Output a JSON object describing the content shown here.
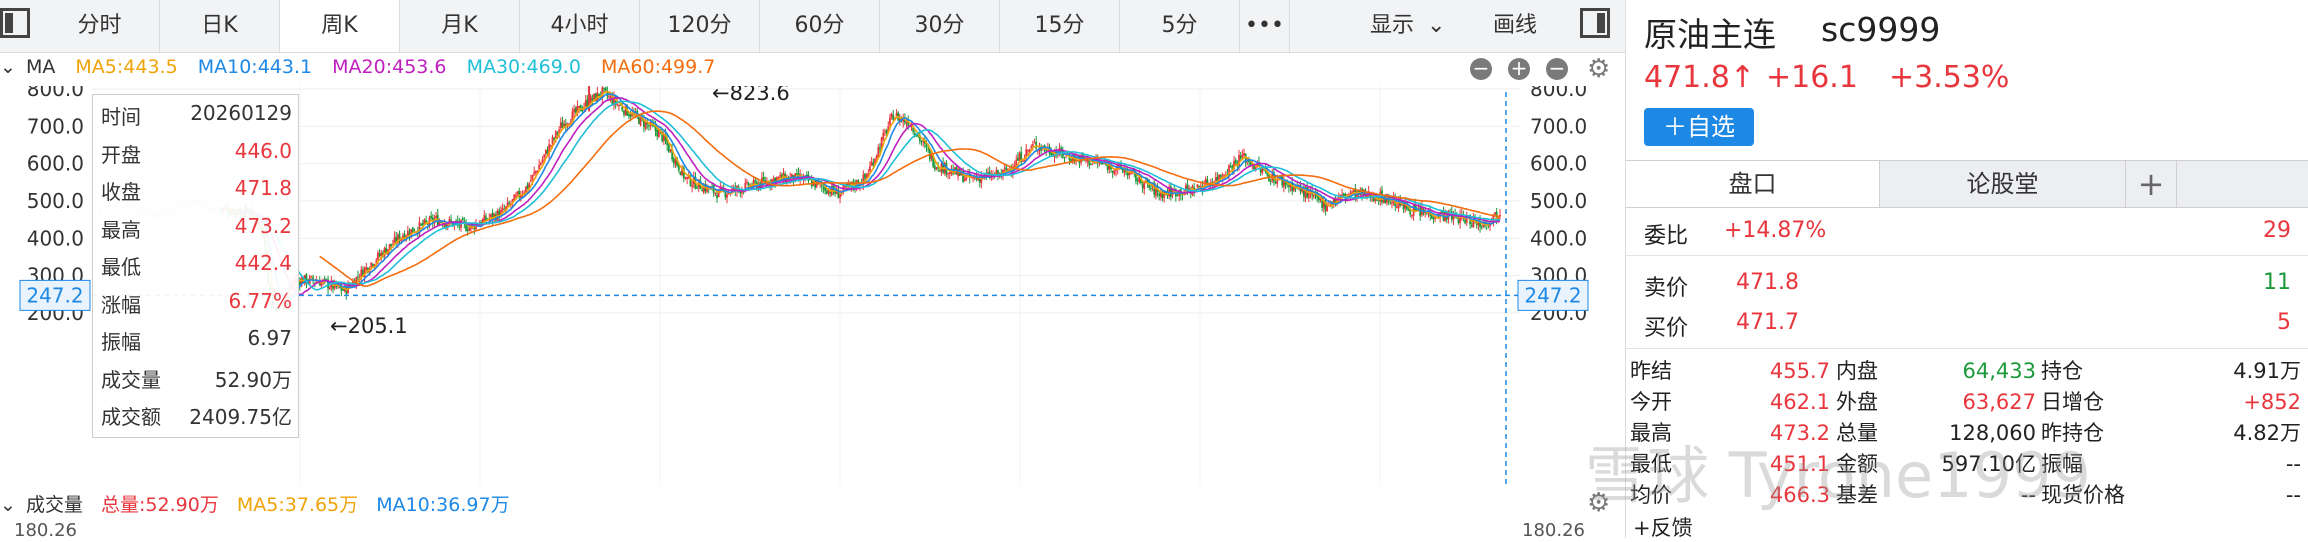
{
  "tabs": [
    "分时",
    "日K",
    "周K",
    "月K",
    "4小时",
    "120分",
    "60分",
    "30分",
    "15分",
    "5分",
    "•••"
  ],
  "active_tab": "周K",
  "toolbar": {
    "display": "显示",
    "drawline": "画线"
  },
  "ma_legend": {
    "title": "MA",
    "ma5": "MA5:443.5",
    "ma10": "MA10:443.1",
    "ma20": "MA20:453.6",
    "ma30": "MA30:469.0",
    "ma60": "MA60:499.7"
  },
  "colors": {
    "ma5": "#f0a30a",
    "ma10": "#1e88e5",
    "ma20": "#c01fc0",
    "ma30": "#1fbfd8",
    "ma60": "#f46d0f",
    "up": "#e8363d",
    "down": "#1c9a3b",
    "accent": "#1e88e5"
  },
  "chart": {
    "y_ticks": [
      "800.0",
      "700.0",
      "600.0",
      "500.0",
      "400.0",
      "300.0",
      "200.0"
    ],
    "y_tick_values": [
      800,
      700,
      600,
      500,
      400,
      300,
      200
    ],
    "y_range": [
      180,
      840
    ],
    "crosshair_value": "247.2",
    "high_label": "←823.6",
    "low_label": "←205.1"
  },
  "info": {
    "rows": [
      {
        "k": "时间",
        "v": "20260129",
        "c": "normal"
      },
      {
        "k": "开盘",
        "v": "446.0",
        "c": "red"
      },
      {
        "k": "收盘",
        "v": "471.8",
        "c": "red"
      },
      {
        "k": "最高",
        "v": "473.2",
        "c": "red"
      },
      {
        "k": "最低",
        "v": "442.4",
        "c": "red"
      },
      {
        "k": "涨幅",
        "v": "6.77%",
        "c": "red"
      },
      {
        "k": "振幅",
        "v": "6.97",
        "c": "normal"
      },
      {
        "k": "成交量",
        "v": "52.90万",
        "c": "normal"
      },
      {
        "k": "成交额",
        "v": "2409.75亿",
        "c": "normal"
      }
    ]
  },
  "volume": {
    "title": "成交量",
    "total": "总量:52.90万",
    "ma5": "MA5:37.65万",
    "ma10": "MA10:36.97万",
    "partial_left": "180.26",
    "partial_right": "180.26"
  },
  "quote": {
    "name": "原油主连",
    "code": "sc9999",
    "price": "471.8↑",
    "change": "+16.1",
    "change_pct": "+3.53%",
    "add_watch": "＋自选",
    "tabs": [
      "盘口",
      "论股堂",
      "+"
    ],
    "weibi_label": "委比",
    "weibi_value": "+14.87%",
    "weibi_count": "29",
    "sell_label": "卖价",
    "sell_price": "471.8",
    "sell_qty": "11",
    "buy_label": "买价",
    "buy_price": "471.7",
    "buy_qty": "5",
    "stats": [
      [
        "昨结",
        "455.7",
        "内盘",
        "64,433",
        "持仓",
        "4.91万"
      ],
      [
        "今开",
        "462.1",
        "外盘",
        "63,627",
        "日增仓",
        "+852"
      ],
      [
        "最高",
        "473.2",
        "总量",
        "128,060",
        "昨持仓",
        "4.82万"
      ],
      [
        "最低",
        "451.1",
        "金额",
        "597.10亿",
        "振幅",
        "--"
      ],
      [
        "均价",
        "466.3",
        "基差",
        "--",
        "现货价格",
        "--"
      ]
    ],
    "feedback": "+反馈"
  },
  "watermark": "雪球 Tyrone1999"
}
